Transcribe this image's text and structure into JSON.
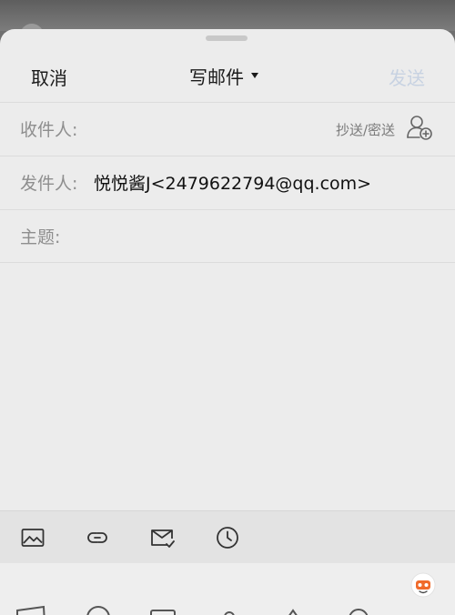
{
  "nav": {
    "cancel_label": "取消",
    "title": "写邮件",
    "send_label": "发送"
  },
  "fields": {
    "to_label": "收件人:",
    "cc_bcc_label": "抄送/密送",
    "from_label": "发件人:",
    "from_value": "悦悦酱J<2479622794@qq.com>",
    "subject_label": "主题:"
  },
  "toolbar": {
    "icons": [
      "image-icon",
      "link-icon",
      "mail-check-icon",
      "clock-icon"
    ]
  },
  "colors": {
    "sheet_bg": "#ececec",
    "send_disabled": "#c7d2e2",
    "label_gray": "#8e8e8e"
  }
}
